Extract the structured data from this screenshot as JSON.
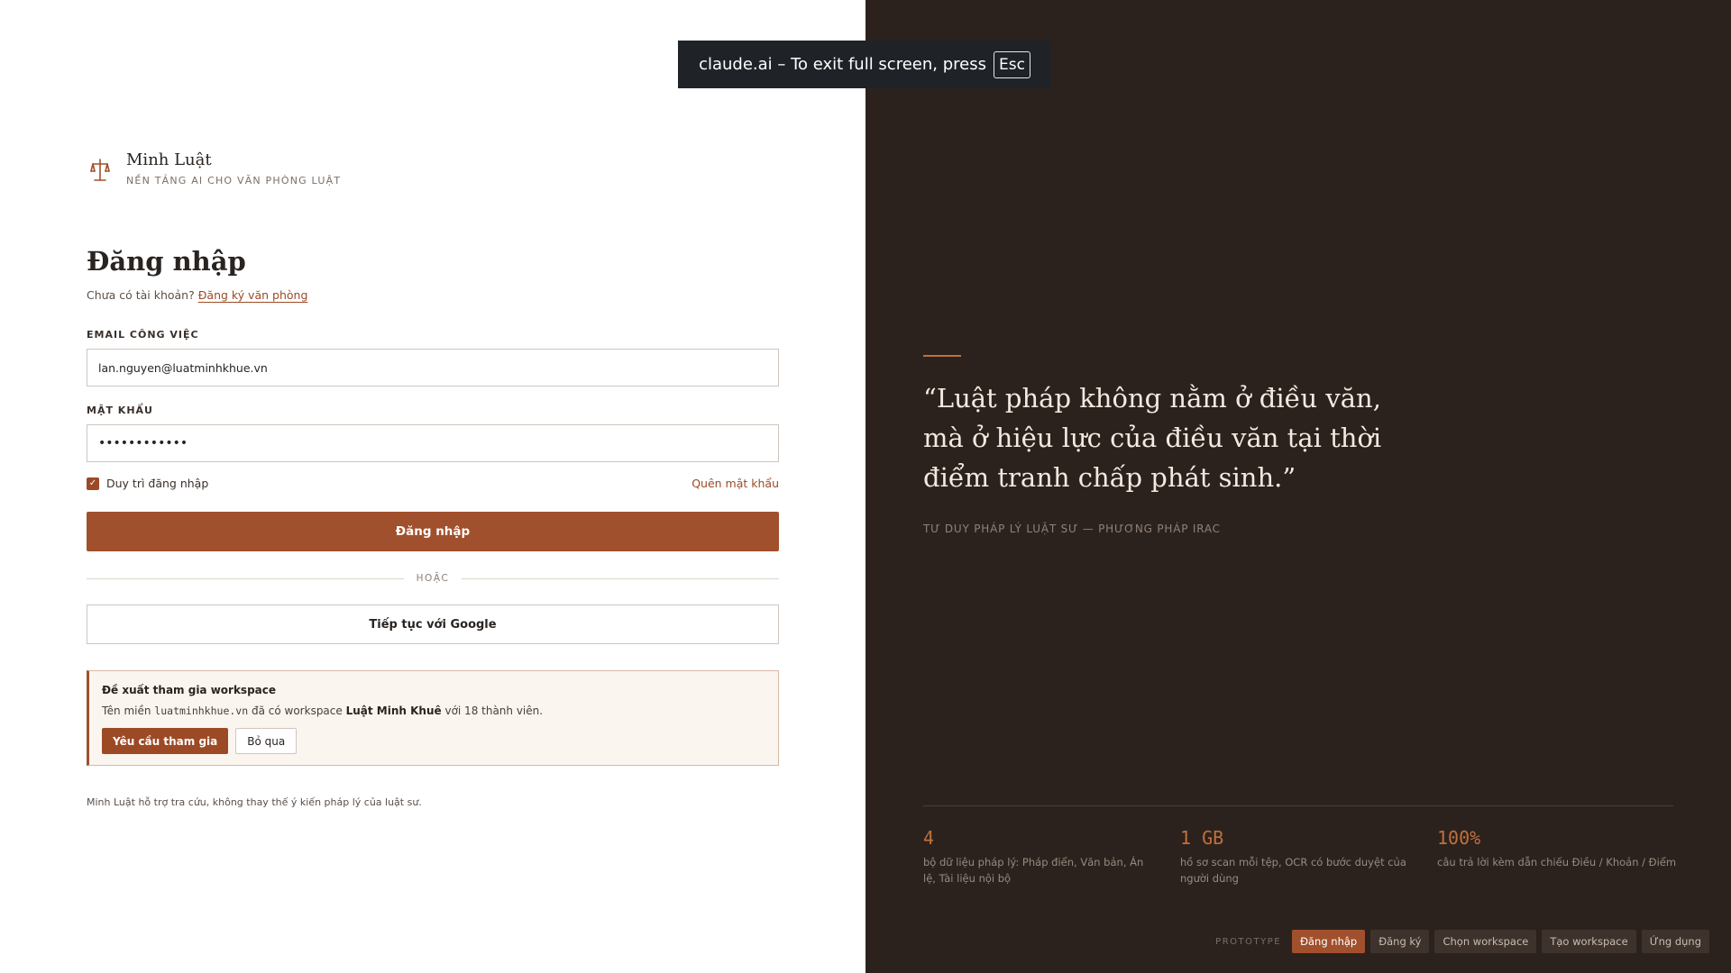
{
  "brand": {
    "name": "Minh Luật",
    "tagline": "NỀN TẢNG AI CHO VĂN PHÒNG LUẬT",
    "icon": "scales-icon"
  },
  "login": {
    "title": "Đăng nhập",
    "no_account_text": "Chưa có tài khoản?",
    "register_link": "Đăng ký văn phòng",
    "email_label": "EMAIL CÔNG VIỆC",
    "email_value": "lan.nguyen@luatminhkhue.vn",
    "password_label": "MẬT KHẨU",
    "password_value": "••••••••••••",
    "remember_label": "Duy trì đăng nhập",
    "remember_checked": true,
    "forgot_link": "Quên mật khẩu",
    "submit_label": "Đăng nhập",
    "divider_label": "HOẶC",
    "google_label": "Tiếp tục với Google"
  },
  "suggestion": {
    "title": "Đề xuất tham gia workspace",
    "text_prefix": "Tên miền",
    "domain": "luatminhkhue.vn",
    "text_middle": "đã có workspace",
    "workspace_name": "Luật Minh Khuê",
    "text_suffix": "với 18 thành viên.",
    "join_label": "Yêu cầu tham gia",
    "skip_label": "Bỏ qua"
  },
  "disclaimer": "Minh Luật hỗ trợ tra cứu, không thay thế ý kiến pháp lý của luật sư.",
  "hero": {
    "quote_line1": "“Luật pháp không nằm ở điều văn,",
    "quote_line2": "mà ở hiệu lực của điều văn tại thời",
    "quote_line3": "điểm tranh chấp phát sinh.”",
    "source": "TƯ DUY PHÁP LÝ LUẬT SƯ — PHƯƠNG PHÁP IRAC"
  },
  "stats": [
    {
      "value": "4",
      "desc": "bộ dữ liệu pháp lý: Pháp điển, Văn bản, Án lệ, Tài liệu nội bộ"
    },
    {
      "value": "1 GB",
      "desc": "hồ sơ scan mỗi tệp, OCR có bước duyệt của người dùng"
    },
    {
      "value": "100%",
      "desc": "câu trả lời kèm dẫn chiếu Điều / Khoản / Điểm"
    }
  ],
  "prototype": {
    "label": "PROTOTYPE",
    "tabs": [
      "Đăng nhập",
      "Đăng ký",
      "Chọn workspace",
      "Tạo workspace",
      "Ứng dụng"
    ],
    "active_index": 0
  },
  "fullscreen_toast": {
    "text": "claude.ai – To exit full screen, press",
    "key": "Esc"
  },
  "colors": {
    "accent": "#a0502c",
    "dark_panel": "#2c221d",
    "stat_value": "#c0703e"
  }
}
